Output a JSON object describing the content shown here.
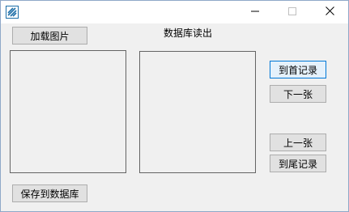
{
  "window": {
    "minimize_glyph": "—",
    "maximize_glyph": "☐",
    "close_glyph": "✕"
  },
  "buttons": {
    "load_image": "加载图片",
    "save_to_db": "保存到数据库",
    "first_record": "到首记录",
    "next": "下一张",
    "previous": "上一张",
    "last_record": "到尾记录"
  },
  "labels": {
    "db_read": "数据库读出"
  },
  "colors": {
    "window_bg": "#f0f0f0",
    "titlebar_bg": "#ffffff",
    "button_bg": "#e1e1e1",
    "button_border": "#adadad",
    "focus_border": "#0078d7",
    "icon_accent": "#1e6fa8"
  },
  "icons": {
    "app": "app-icon",
    "minimize": "minimize-icon",
    "maximize": "maximize-icon",
    "close": "close-icon"
  }
}
